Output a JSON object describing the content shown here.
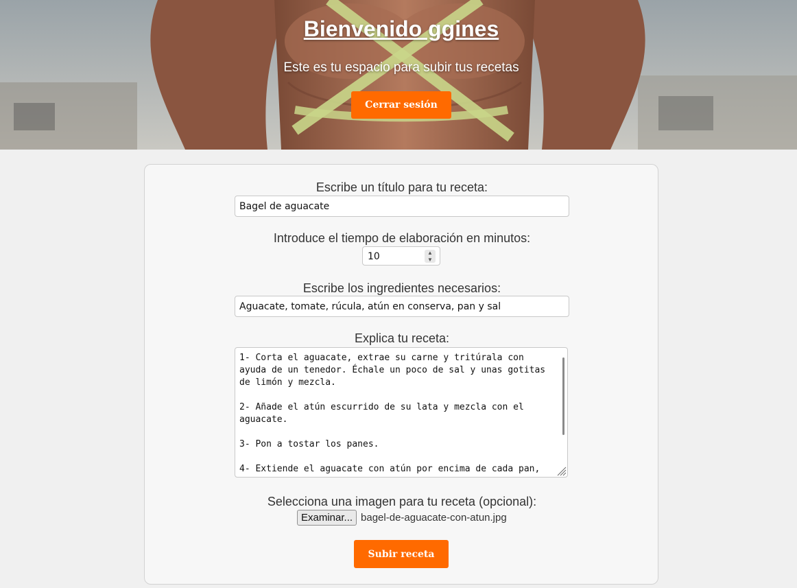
{
  "header": {
    "title": "Bienvenido ggines",
    "subtitle": "Este es tu espacio para subir tus recetas",
    "logout_label": "Cerrar sesión"
  },
  "form": {
    "title_label": "Escribe un título para tu receta:",
    "title_value": "Bagel de aguacate",
    "time_label": "Introduce el tiempo de elaboración en minutos:",
    "time_value": "10",
    "ingredients_label": "Escribe los ingredientes necesarios:",
    "ingredients_value": "Aguacate, tomate, rúcula, atún en conserva, pan y sal",
    "recipe_label": "Explica tu receta:",
    "recipe_value": "1- Corta el aguacate, extrae su carne y tritúrala con ayuda de un tenedor. Échale un poco de sal y unas gotitas de limón y mezcla.\n\n2- Añade el atún escurrido de su lata y mezcla con el aguacate.\n\n3- Pon a tostar los panes.\n\n4- Extiende el aguacate con atún por encima de cada pan,",
    "image_label": "Selecciona una imagen para tu receta (opcional):",
    "browse_label": "Examinar...",
    "file_name": "bagel-de-aguacate-con-atun.jpg",
    "submit_label": "Subir receta"
  },
  "colors": {
    "accent": "#ff6a00",
    "page_background": "#f0f0f0",
    "card_background": "#f7f7f7"
  }
}
